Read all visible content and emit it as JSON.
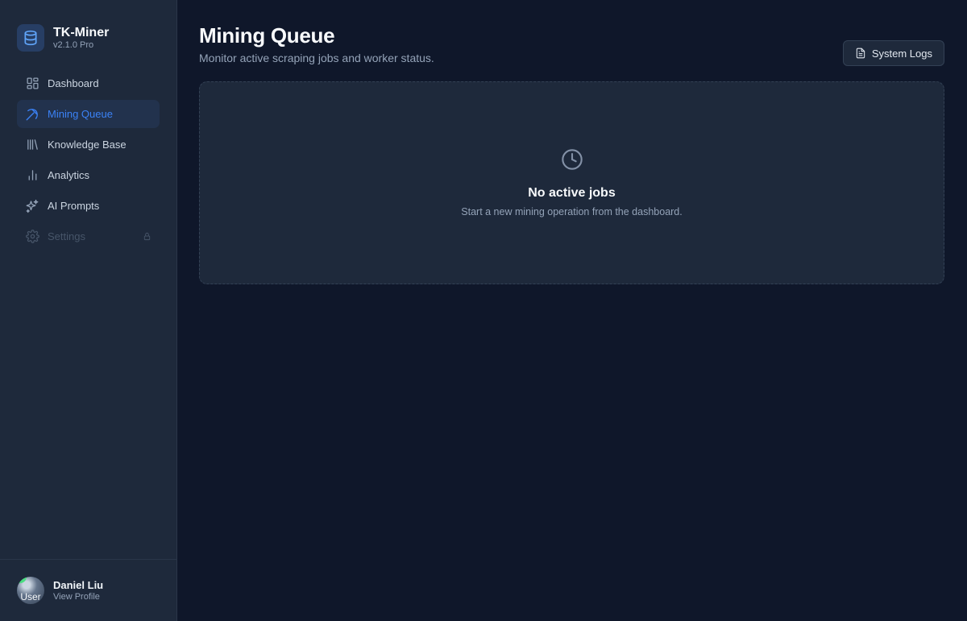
{
  "brand": {
    "name": "TK-Miner",
    "version": "v2.1.0 Pro",
    "logo_icon": "database-icon",
    "accent": "#3b82f6"
  },
  "sidebar": {
    "items": [
      {
        "label": "Dashboard",
        "icon": "dashboard-grid-icon",
        "active": false,
        "locked": false
      },
      {
        "label": "Mining Queue",
        "icon": "pickaxe-icon",
        "active": true,
        "locked": false
      },
      {
        "label": "Knowledge Base",
        "icon": "library-icon",
        "active": false,
        "locked": false
      },
      {
        "label": "Analytics",
        "icon": "bar-chart-icon",
        "active": false,
        "locked": false
      },
      {
        "label": "AI Prompts",
        "icon": "sparkles-icon",
        "active": false,
        "locked": false
      },
      {
        "label": "Settings",
        "icon": "gear-icon",
        "active": false,
        "locked": true
      }
    ]
  },
  "user": {
    "name": "Daniel Liu",
    "link": "View Profile",
    "avatar_alt": "User"
  },
  "page": {
    "title": "Mining Queue",
    "subtitle": "Monitor active scraping jobs and worker status.",
    "logs_button": "System Logs"
  },
  "empty_state": {
    "icon": "clock-icon",
    "title": "No active jobs",
    "description": "Start a new mining operation from the dashboard."
  }
}
